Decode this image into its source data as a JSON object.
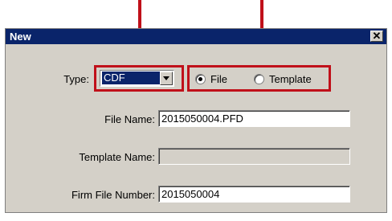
{
  "dialog": {
    "title": "New",
    "close_glyph": "✕"
  },
  "type_label": "Type:",
  "type_select": {
    "value": "CDF"
  },
  "radio": {
    "file_label": "File",
    "template_label": "Template",
    "selected": "File"
  },
  "fields": {
    "file_name": {
      "label": "File Name:",
      "value": "2015050004.PFD"
    },
    "template_name": {
      "label": "Template Name:",
      "value": ""
    },
    "firm_file_number": {
      "label": "Firm File Number:",
      "value": "2015050004"
    }
  },
  "colors": {
    "annotation": "#c0101a",
    "titlebar": "#0a246a",
    "dialog_bg": "#d4d0c8"
  }
}
